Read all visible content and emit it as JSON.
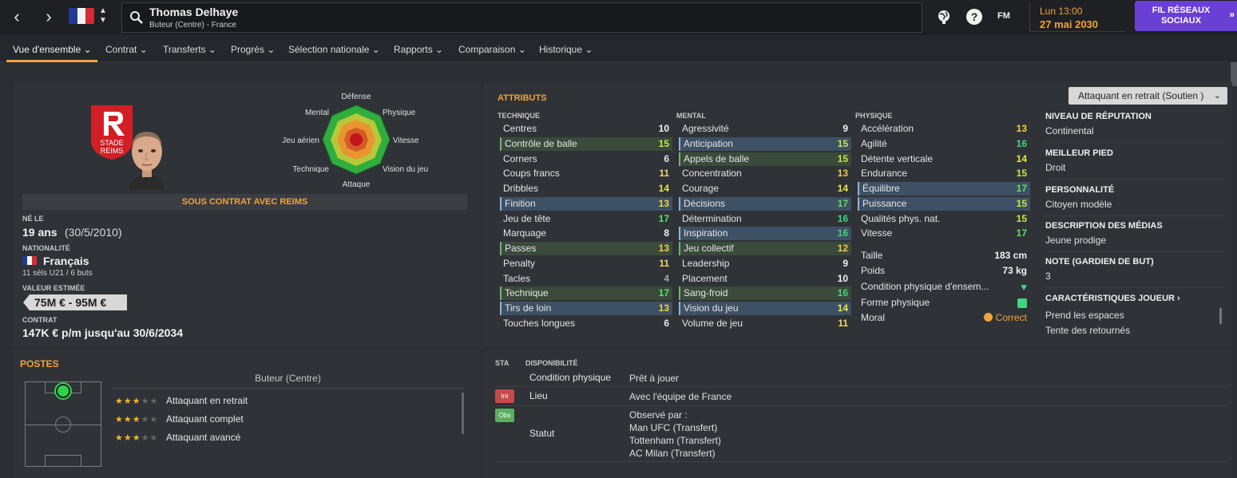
{
  "header": {
    "player_name": "Thomas Delhaye",
    "player_sub": "Buteur (Centre) - France",
    "time": "Lun 13:00",
    "date": "27 mai 2030",
    "fm_logo": "FM",
    "social_button": "FIL RÉSEAUX SOCIAUX",
    "icons": [
      "back-arrow",
      "forward-arrow",
      "france-flag",
      "search-icon",
      "globe-icon",
      "help-icon"
    ]
  },
  "tabs": [
    {
      "label": "Vue d'ensemble",
      "active": true
    },
    {
      "label": "Contrat"
    },
    {
      "label": "Transferts"
    },
    {
      "label": "Progrès"
    },
    {
      "label": "Sélection nationale"
    },
    {
      "label": "Rapports"
    },
    {
      "label": "Comparaison"
    },
    {
      "label": "Historique"
    }
  ],
  "overview": {
    "radar_labels": {
      "top": "Défense",
      "top_right": "Physique",
      "right": "Vitesse",
      "bottom_right": "Vision du jeu",
      "bottom": "Attaque",
      "bottom_left": "Technique",
      "left": "Jeu aérien",
      "top_left": "Mental"
    },
    "contract_status": "SOUS CONTRAT AVEC REIMS",
    "born_label": "NÉ LE",
    "born_value": "19 ans",
    "born_date": "(30/5/2010)",
    "nationality_label": "NATIONALITÉ",
    "nationality_value": "Français",
    "caps": "11 séls U21 / 6 buts",
    "value_label": "VALEUR ESTIMÉE",
    "value": "75M € - 95M €",
    "contract_label": "CONTRAT",
    "contract_value": "147K € p/m jusqu'au 30/6/2034",
    "club_logo_text": [
      "STADE",
      "REIMS"
    ]
  },
  "attributes": {
    "title": "ATTRIBUTS",
    "technique_head": "TECHNIQUE",
    "mental_head": "MENTAL",
    "physique_head": "PHYSIQUE",
    "technique": [
      {
        "name": "Centres",
        "value": "10"
      },
      {
        "name": "Contrôle de balle",
        "value": "15"
      },
      {
        "name": "Corners",
        "value": "6"
      },
      {
        "name": "Coups francs",
        "value": "11"
      },
      {
        "name": "Dribbles",
        "value": "14"
      },
      {
        "name": "Finition",
        "value": "13"
      },
      {
        "name": "Jeu de tête",
        "value": "17"
      },
      {
        "name": "Marquage",
        "value": "8"
      },
      {
        "name": "Passes",
        "value": "13"
      },
      {
        "name": "Penalty",
        "value": "11"
      },
      {
        "name": "Tacles",
        "value": "4"
      },
      {
        "name": "Technique",
        "value": "17"
      },
      {
        "name": "Tirs de loin",
        "value": "13"
      },
      {
        "name": "Touches longues",
        "value": "6"
      }
    ],
    "mental": [
      {
        "name": "Agressivité",
        "value": "9"
      },
      {
        "name": "Anticipation",
        "value": "15"
      },
      {
        "name": "Appels de balle",
        "value": "15"
      },
      {
        "name": "Concentration",
        "value": "13"
      },
      {
        "name": "Courage",
        "value": "14"
      },
      {
        "name": "Décisions",
        "value": "17"
      },
      {
        "name": "Détermination",
        "value": "16"
      },
      {
        "name": "Inspiration",
        "value": "16"
      },
      {
        "name": "Jeu collectif",
        "value": "12"
      },
      {
        "name": "Leadership",
        "value": "9"
      },
      {
        "name": "Placement",
        "value": "10"
      },
      {
        "name": "Sang-froid",
        "value": "16"
      },
      {
        "name": "Vision du jeu",
        "value": "14"
      },
      {
        "name": "Volume de jeu",
        "value": "11"
      }
    ],
    "physique": [
      {
        "name": "Accélération",
        "value": "13"
      },
      {
        "name": "Agilité",
        "value": "16"
      },
      {
        "name": "Détente verticale",
        "value": "14"
      },
      {
        "name": "Endurance",
        "value": "15"
      },
      {
        "name": "Équilibre",
        "value": "17"
      },
      {
        "name": "Puissance",
        "value": "15"
      },
      {
        "name": "Qualités phys. nat.",
        "value": "15"
      },
      {
        "name": "Vitesse",
        "value": "17"
      }
    ],
    "height_label": "Taille",
    "height": "183 cm",
    "weight_label": "Poids",
    "weight": "73 kg",
    "condition_label": "Condition physique d'ensem...",
    "form_label": "Forme physique",
    "morale_label": "Moral",
    "morale_value": "Correct"
  },
  "info": {
    "role_dropdown": "Attaquant en retrait (Soutien )",
    "items": [
      {
        "h": "NIVEAU DE RÉPUTATION",
        "v": "Continental"
      },
      {
        "h": "MEILLEUR PIED",
        "v": "Droit"
      },
      {
        "h": "PERSONNALITÉ",
        "v": "Citoyen modèle"
      },
      {
        "h": "DESCRIPTION DES MÉDIAS",
        "v": "Jeune prodige"
      },
      {
        "h": "NOTE (GARDIEN DE BUT)",
        "v": "3"
      }
    ],
    "traits_head": "CARACTÉRISTIQUES JOUEUR ›",
    "traits": [
      "Prend les espaces",
      "Tente des retournés"
    ]
  },
  "positions": {
    "title": "POSTES",
    "main_position": "Buteur (Centre)",
    "roles": [
      {
        "label": "Attaquant en retrait",
        "stars": 3
      },
      {
        "label": "Attaquant complet",
        "stars": 3
      },
      {
        "label": "Attaquant avancé",
        "stars": 3
      }
    ]
  },
  "availability": {
    "sta_head": "STA",
    "disp_head": "DISPONIBILITÉ",
    "condition_label": "Condition physique",
    "condition_value": "Prêt à jouer",
    "location_label": "Lieu",
    "location_value": "Avec l'équipe de France",
    "status_label": "Statut",
    "status_lines": [
      "Observé par :",
      "Man UFC (Transfert)",
      "Tottenham (Transfert)",
      "AC Milan (Transfert)"
    ],
    "tag_int": "Int",
    "tag_obs": "Obs"
  },
  "colors": {
    "accent": "#f0a33a",
    "purple": "#6a3fd4",
    "highlight_blue": "#3e5064"
  }
}
